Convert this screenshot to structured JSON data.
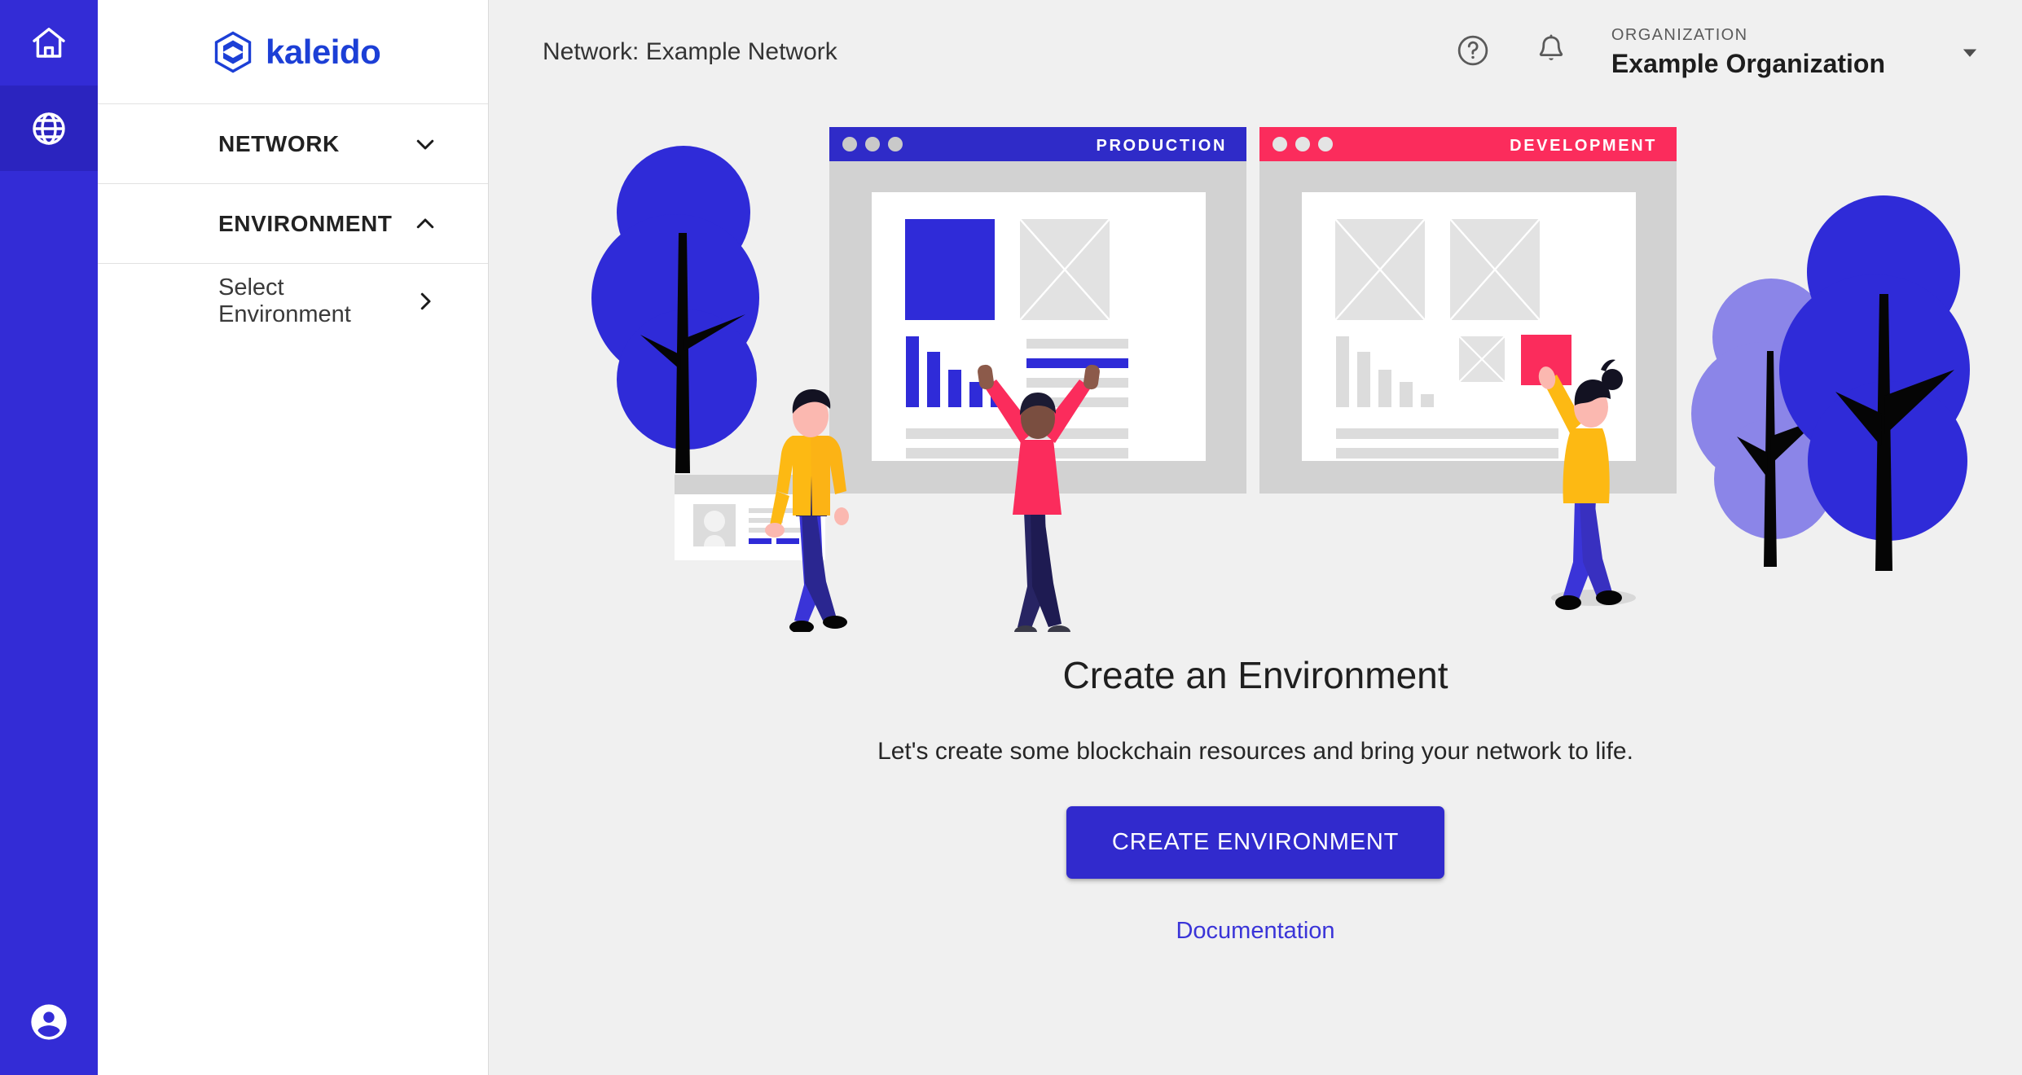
{
  "rail": {
    "items": [
      {
        "name": "home",
        "icon": "home-icon",
        "active": false
      },
      {
        "name": "network",
        "icon": "globe-icon",
        "active": true
      }
    ],
    "account": {
      "name": "account",
      "icon": "account-circle-icon"
    },
    "background_color": "#332CD6",
    "active_background_color": "#2B24BF"
  },
  "sidebar": {
    "brand": {
      "text": "kaleido",
      "icon": "kaleido-logo-icon",
      "color": "#1C3FD6"
    },
    "sections": [
      {
        "label": "NETWORK",
        "chevron": "chevron-down-icon",
        "expanded": false
      },
      {
        "label": "ENVIRONMENT",
        "chevron": "chevron-up-icon",
        "expanded": true
      }
    ],
    "sub_items": [
      {
        "label": "Select Environment",
        "chevron": "chevron-right-icon"
      }
    ]
  },
  "topbar": {
    "title": "Network: Example Network",
    "help_icon": "help-circle-icon",
    "notifications_icon": "bell-icon",
    "organization": {
      "label": "ORGANIZATION",
      "name": "Example Organization",
      "caret": "caret-down-icon"
    }
  },
  "main": {
    "heading": "Create an Environment",
    "subheading": "Let's create some blockchain resources and bring your network to life.",
    "cta_label": "CREATE ENVIRONMENT",
    "doc_link_label": "Documentation",
    "cta_color": "#312ACD",
    "link_color": "#3A34D8"
  },
  "illustration": {
    "windows": [
      {
        "label": "PRODUCTION",
        "bar_color": "#2F2BC8",
        "accent_color": "#2F2BD8"
      },
      {
        "label": "DEVELOPMENT",
        "bar_color": "#FB2C5C",
        "accent_color": "#FB2C5C"
      }
    ],
    "colors": {
      "tree_blue": "#2F2BD8",
      "tree_light_purple": "#8B85E8",
      "trunk": "#050505",
      "shirt_red": "#FB2C5C",
      "jacket_yellow": "#FDB913",
      "pants_blue": "#3A34D8",
      "pants_navy": "#272463",
      "skin": "#FBB8B0",
      "hair": "#1C1B33",
      "panel_gray": "#D2D2D2",
      "placeholder_gray": "#E2E2E2",
      "line_gray": "#DCDCDC"
    }
  }
}
